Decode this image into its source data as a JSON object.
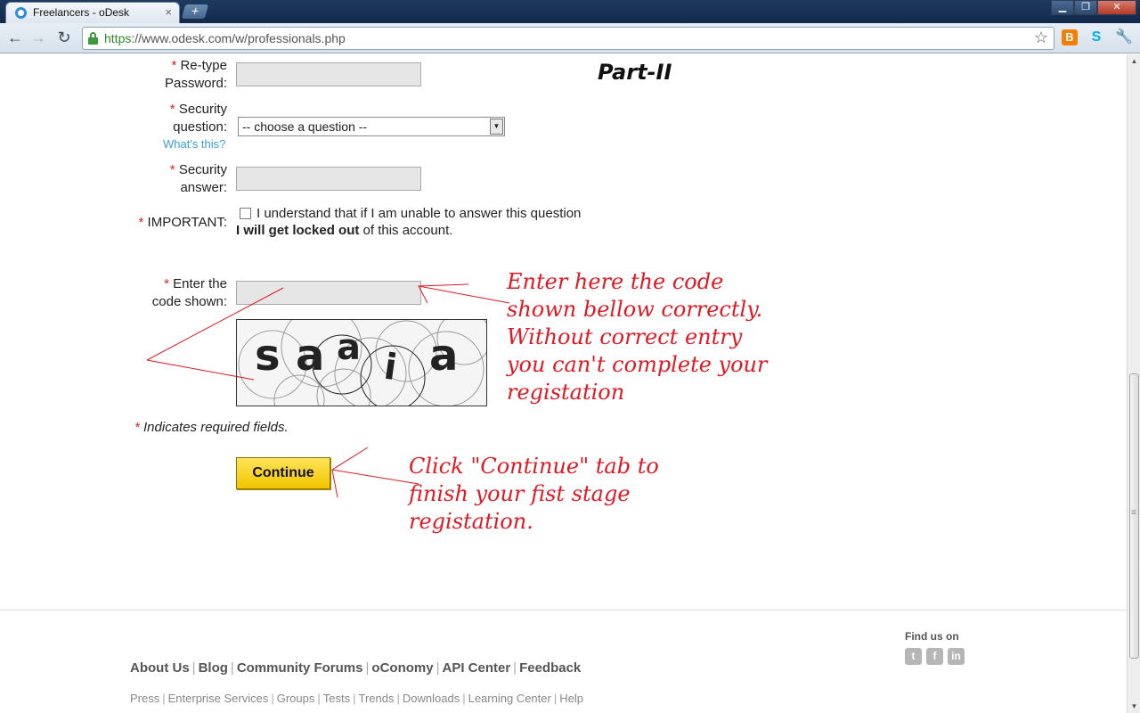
{
  "browser": {
    "tab_title": "Freelancers - oDesk",
    "tab_close": "×",
    "new_tab": "+",
    "url_scheme": "https",
    "url_rest": "://www.odesk.com/w/professionals.php",
    "win_min": "▁",
    "win_max": "❐",
    "win_close": "✕"
  },
  "form": {
    "retype_password": {
      "label_line1": "Re-type",
      "label_line2": "Password:"
    },
    "security_question": {
      "label_line1": "Security",
      "label_line2": "question:",
      "selected": "-- choose a question --",
      "help_link": "What's this?"
    },
    "security_answer": {
      "label_line1": "Security",
      "label_line2": "answer:"
    },
    "important": {
      "label": "IMPORTANT:",
      "checkbox_text": "I understand that if I am unable to answer this question",
      "bold_text": "I will get locked out",
      "rest_text": " of this account."
    },
    "code": {
      "label_line1": "Enter the",
      "label_line2": "code shown:"
    },
    "captcha_letters": [
      "s",
      "a",
      "a",
      "i",
      "a"
    ],
    "required_marker": "*",
    "required_note": "Indicates required fields.",
    "continue_label": "Continue"
  },
  "annotations": {
    "part_title": "Part-II",
    "code_note": [
      "Enter here the code",
      "shown bellow correctly.",
      "Without correct entry",
      "you can't complete your",
      "registation"
    ],
    "continue_note": [
      "Click \"Continue\" tab to",
      "finish your fist stage",
      "registation."
    ]
  },
  "footer": {
    "find_us": "Find us on",
    "main_links": [
      "About Us",
      "Blog",
      "Community Forums",
      "oConomy",
      "API Center",
      "Feedback"
    ],
    "sub_links": [
      "Press",
      "Enterprise Services",
      "Groups",
      "Tests",
      "Trends",
      "Downloads",
      "Learning Center",
      "Help"
    ]
  },
  "colors": {
    "required": "#dd2222",
    "annotation": "#e01a24",
    "continue_button": "#f2c500",
    "link": "#3aa0d8"
  }
}
